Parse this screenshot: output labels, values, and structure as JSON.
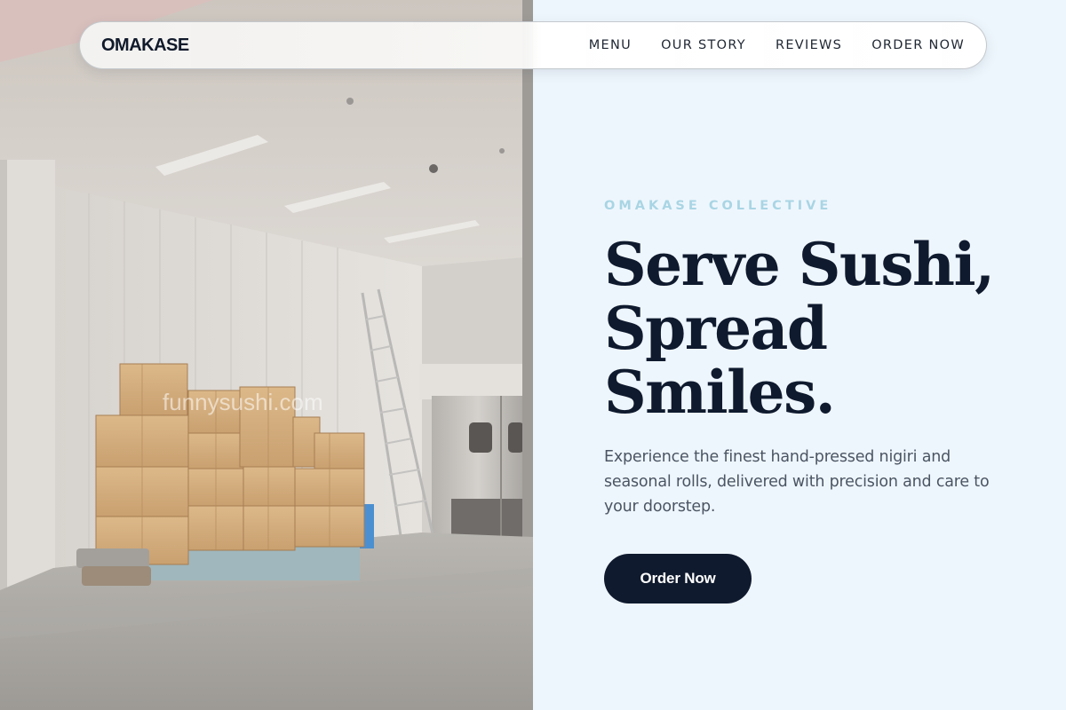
{
  "nav": {
    "brand": "OMAKASE",
    "links": [
      "MENU",
      "OUR STORY",
      "REVIEWS",
      "ORDER NOW"
    ]
  },
  "hero": {
    "eyebrow": "OMAKASE COLLECTIVE",
    "headline": [
      "Serve Sushi,",
      "Spread",
      "Smiles."
    ],
    "subtext": "Experience the finest hand-pressed nigiri and seasonal rolls, delivered with precision and care to your doorstep.",
    "cta_label": "Order Now"
  },
  "image": {
    "watermark": "funnysushi.com",
    "subject": "warehouse-loading-dock"
  },
  "colors": {
    "primary": "#0f1a2e",
    "accent": "#a9d5e4",
    "background": "#eef6fd",
    "body_text": "#4b5563"
  }
}
